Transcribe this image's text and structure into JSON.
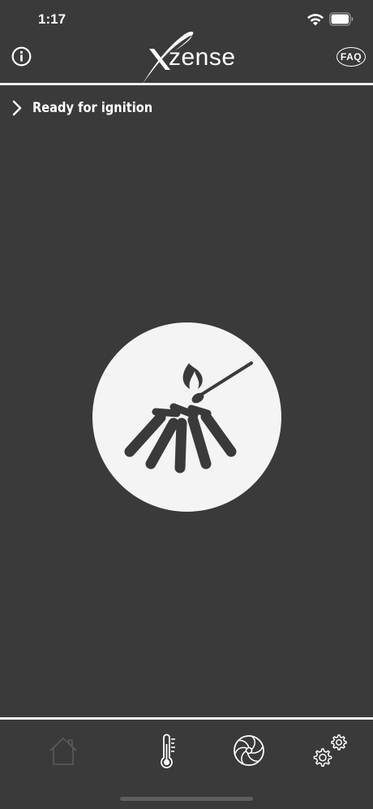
{
  "status_bar": {
    "time": "1:17"
  },
  "header": {
    "logo_text": "zense",
    "faq_label": "FAQ"
  },
  "status": {
    "label": "Ready for ignition"
  },
  "colors": {
    "background": "#3a3a3a",
    "circle": "#f4f4f4",
    "icon_dark": "#3a3a3a",
    "divider": "#f2f2f2"
  },
  "tabs": [
    {
      "icon": "home-icon",
      "state": "selected-dim"
    },
    {
      "icon": "thermometer-icon"
    },
    {
      "icon": "fan-icon"
    },
    {
      "icon": "gears-icon"
    }
  ]
}
